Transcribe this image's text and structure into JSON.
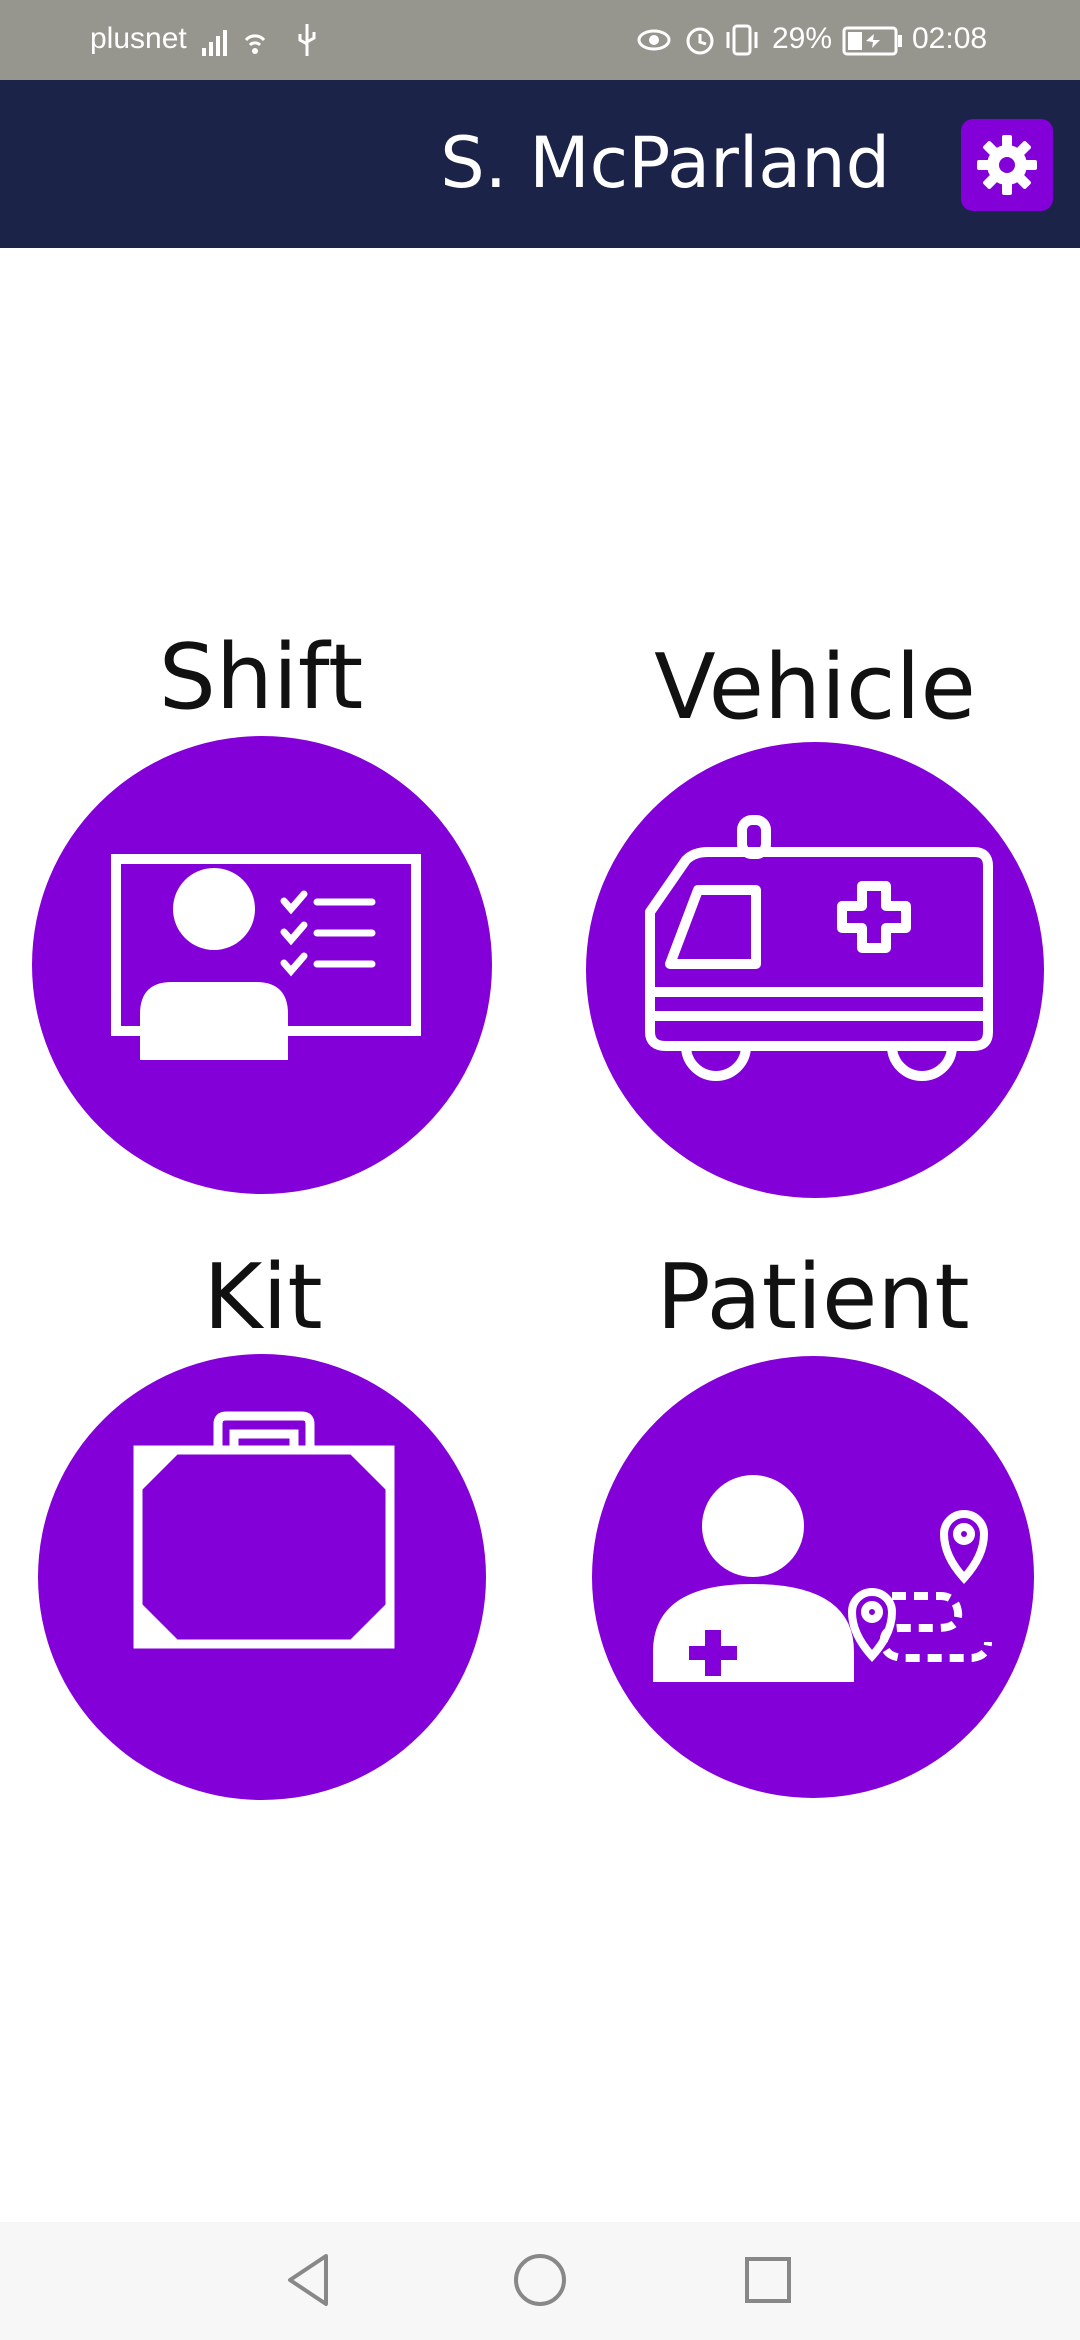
{
  "status_bar": {
    "carrier": "plusnet",
    "battery_percent": "29%",
    "time": "02:08",
    "icons": [
      "signal-icon",
      "wifi-icon",
      "usb-icon",
      "eye-comfort-icon",
      "alarm-icon",
      "vibrate-icon",
      "battery-icon"
    ]
  },
  "header": {
    "user_name": "S. McParland",
    "settings_icon": "gear-icon"
  },
  "tiles": [
    {
      "label": "Shift",
      "icon": "id-card-checklist-icon"
    },
    {
      "label": "Vehicle",
      "icon": "ambulance-icon"
    },
    {
      "label": "Kit",
      "icon": "medical-kit-icon"
    },
    {
      "label": "Patient",
      "icon": "patient-location-icon"
    }
  ],
  "colors": {
    "status_bar": "#97968e",
    "header": "#1b2349",
    "accent": "#8300d8",
    "background": "#ffffff",
    "nav_bar": "#f7f7f7"
  },
  "nav_bar": {
    "buttons": [
      "back-icon",
      "home-icon",
      "recents-icon"
    ]
  }
}
